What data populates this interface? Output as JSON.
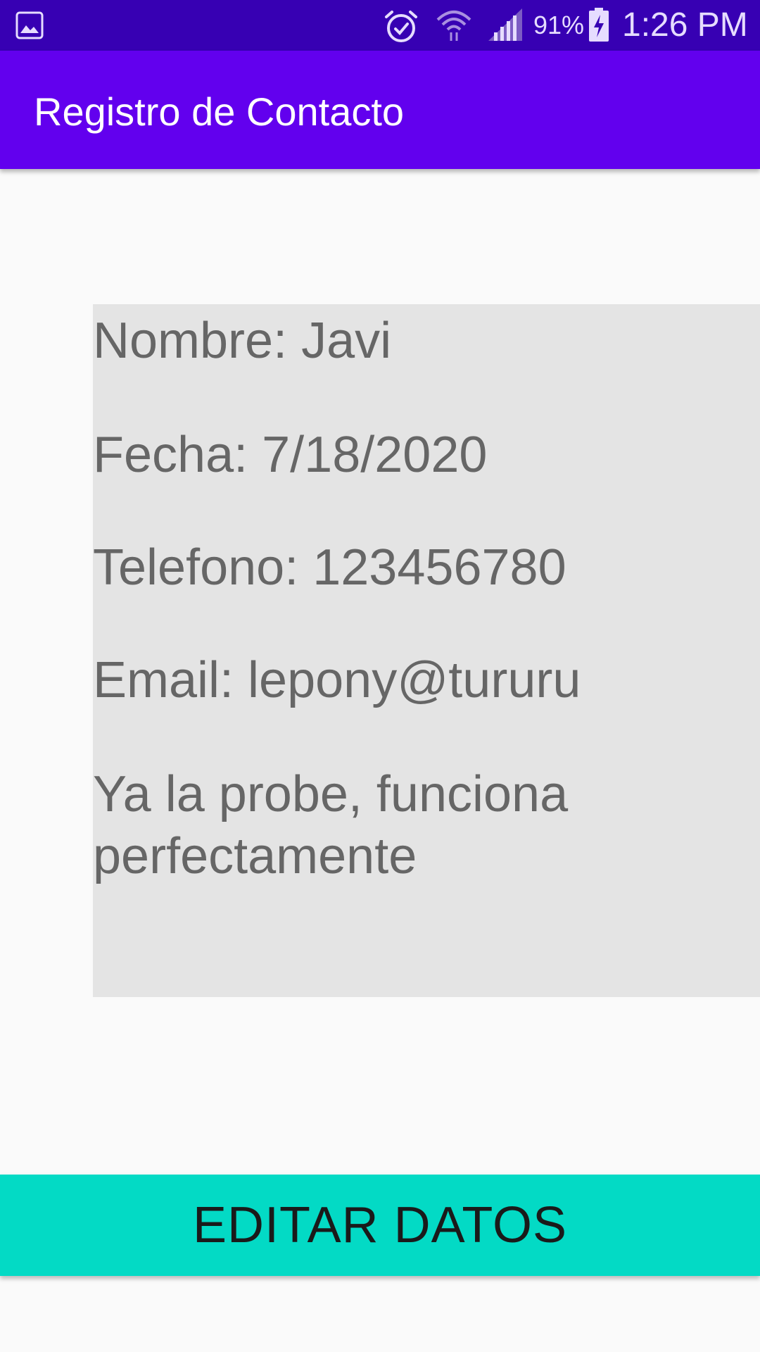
{
  "status_bar": {
    "battery_percent": "91%",
    "time": "1:26 PM",
    "icons": [
      "gallery-icon",
      "alarm-icon",
      "wifi-icon",
      "signal-icon",
      "battery-charging-icon"
    ]
  },
  "app_bar": {
    "title": "Registro de Contacto"
  },
  "contact": {
    "nombre": "Nombre: Javi",
    "fecha": "Fecha: 7/18/2020",
    "telefono": "Telefono: 123456780",
    "email": "Email: lepony@tururu",
    "descripcion": "Ya la probe, funciona perfectamente"
  },
  "actions": {
    "edit_label": "EDITAR DATOS"
  },
  "colors": {
    "status_bar": "#3700b3",
    "app_bar": "#6200ee",
    "button": "#03dac5",
    "card": "#e4e4e4"
  }
}
